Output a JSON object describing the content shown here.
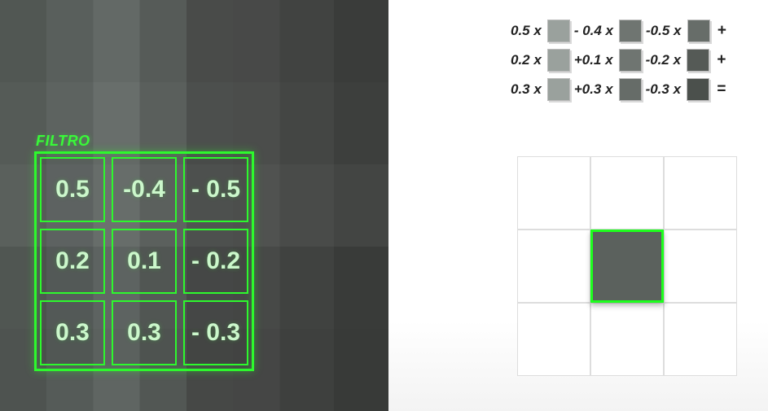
{
  "colors": {
    "accent": "#1dff1d",
    "text_light": "#c8f8c8"
  },
  "filter": {
    "label": "FILTRO",
    "cells": [
      [
        "0.5",
        "-0.4",
        "- 0.5"
      ],
      [
        "0.2",
        "0.1",
        "- 0.2"
      ],
      [
        "0.3",
        "0.3",
        "- 0.3"
      ]
    ]
  },
  "equation": {
    "rows": [
      {
        "terms": [
          {
            "coef": "0.5 x",
            "swatch": "#9aa19d"
          },
          {
            "coef": "- 0.4 x",
            "swatch": "#6f7571"
          },
          {
            "coef": "-0.5 x",
            "swatch": "#676d69"
          }
        ],
        "end": "+"
      },
      {
        "terms": [
          {
            "coef": "0.2 x",
            "swatch": "#9aa19d"
          },
          {
            "coef": "+0.1 x",
            "swatch": "#6f7571"
          },
          {
            "coef": "-0.2 x",
            "swatch": "#555a56"
          }
        ],
        "end": "+"
      },
      {
        "terms": [
          {
            "coef": "0.3 x",
            "swatch": "#9aa19d"
          },
          {
            "coef": "+0.3 x",
            "swatch": "#666c68"
          },
          {
            "coef": "-0.3 x",
            "swatch": "#4b504c"
          }
        ],
        "end": "="
      }
    ]
  },
  "output": {
    "active_index": 4,
    "active_fill": "#5b615d"
  }
}
